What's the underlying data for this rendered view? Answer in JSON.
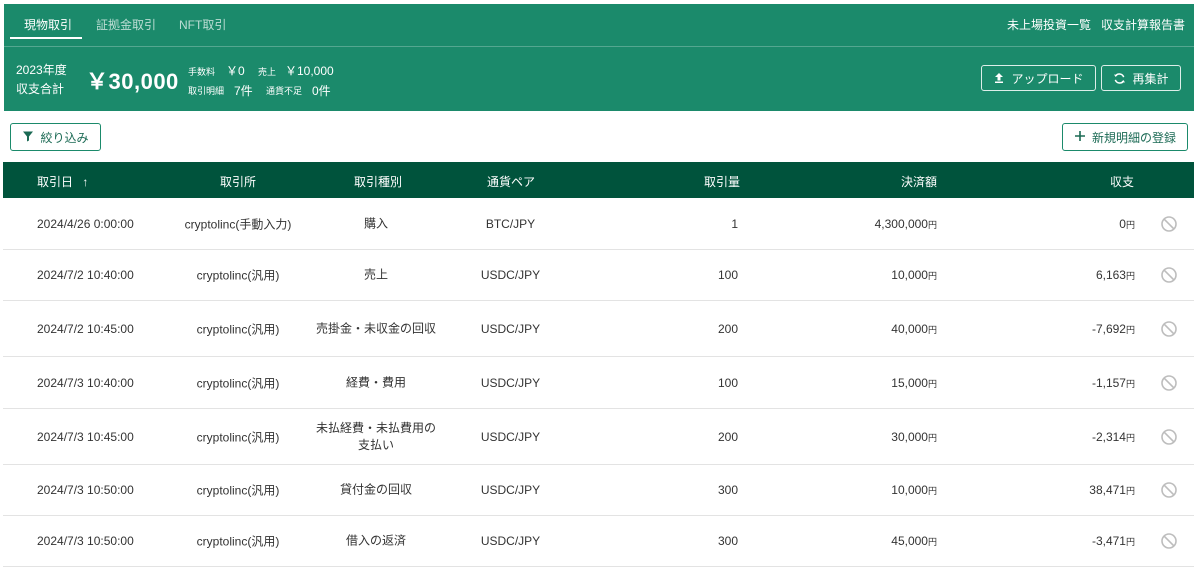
{
  "tabs": [
    {
      "label": "現物取引"
    },
    {
      "label": "証拠金取引"
    },
    {
      "label": "NFT取引"
    }
  ],
  "top_links": {
    "unlisted": "未上場投資一覧",
    "report": "収支計算報告書"
  },
  "summary": {
    "year": "2023年度",
    "total_label": "収支合計",
    "total_amount": "￥30,000",
    "fee_label": "手数料",
    "fee_value": "￥0",
    "sales_label": "売上",
    "sales_value": "￥10,000",
    "details_label": "取引明細",
    "details_value": "7件",
    "shortage_label": "通貨不足",
    "shortage_value": "0件"
  },
  "buttons": {
    "upload": "アップロード",
    "recalculate": "再集計",
    "filter": "絞り込み",
    "new_detail": "新規明細の登録"
  },
  "table": {
    "headers": {
      "date": "取引日",
      "exchange": "取引所",
      "type": "取引種別",
      "pair": "通貨ペア",
      "quantity": "取引量",
      "settlement": "決済額",
      "pnl": "収支"
    },
    "sort_indicator": "↑",
    "unit": "円",
    "rows": [
      {
        "date": "2024/4/26 0:00:00",
        "exchange": "cryptolinc(手動入力)",
        "type": "購入",
        "pair": "BTC/JPY",
        "quantity": "1",
        "settlement": "4,300,000",
        "pnl": "0"
      },
      {
        "date": "2024/7/2 10:40:00",
        "exchange": "cryptolinc(汎用)",
        "type": "売上",
        "pair": "USDC/JPY",
        "quantity": "100",
        "settlement": "10,000",
        "pnl": "6,163"
      },
      {
        "date": "2024/7/2 10:45:00",
        "exchange": "cryptolinc(汎用)",
        "type": "売掛金・未収金の回収",
        "pair": "USDC/JPY",
        "quantity": "200",
        "settlement": "40,000",
        "pnl": "-7,692"
      },
      {
        "date": "2024/7/3 10:40:00",
        "exchange": "cryptolinc(汎用)",
        "type": "経費・費用",
        "pair": "USDC/JPY",
        "quantity": "100",
        "settlement": "15,000",
        "pnl": "-1,157"
      },
      {
        "date": "2024/7/3 10:45:00",
        "exchange": "cryptolinc(汎用)",
        "type": "未払経費・未払費用の支払い",
        "pair": "USDC/JPY",
        "quantity": "200",
        "settlement": "30,000",
        "pnl": "-2,314"
      },
      {
        "date": "2024/7/3 10:50:00",
        "exchange": "cryptolinc(汎用)",
        "type": "貸付金の回収",
        "pair": "USDC/JPY",
        "quantity": "300",
        "settlement": "10,000",
        "pnl": "38,471"
      },
      {
        "date": "2024/7/3 10:50:00",
        "exchange": "cryptolinc(汎用)",
        "type": "借入の返済",
        "pair": "USDC/JPY",
        "quantity": "300",
        "settlement": "45,000",
        "pnl": "-3,471"
      }
    ]
  },
  "colors": {
    "header_green": "#1b8a6b",
    "table_header_green": "#00533c"
  },
  "icons": {
    "upload": "upload-icon",
    "recalculate": "refresh-icon",
    "filter": "filter-icon",
    "new_detail": "plus-icon",
    "row_action": "disable-icon"
  }
}
